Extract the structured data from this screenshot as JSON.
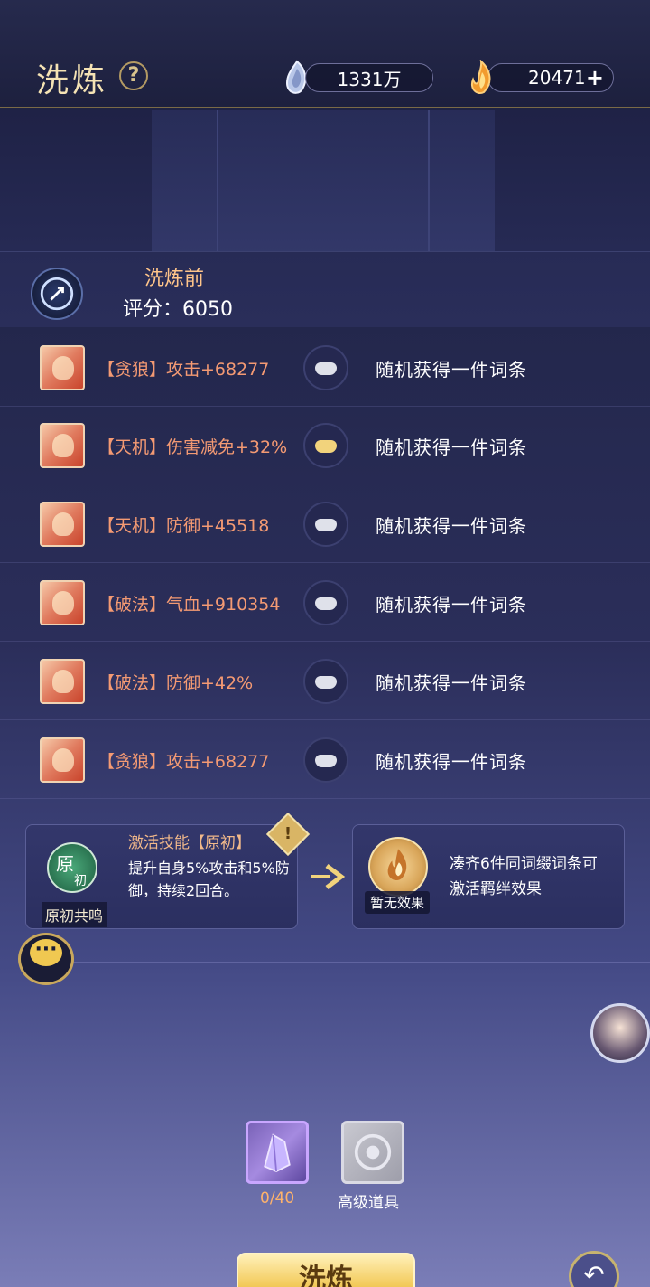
{
  "header": {
    "title": "洗炼",
    "help_icon": "?",
    "currency": [
      {
        "icon": "silver-crystal-icon",
        "value": "1331万"
      },
      {
        "icon": "fire-coin-icon",
        "value": "20471",
        "add": "+"
      }
    ]
  },
  "score": {
    "title": "洗炼前",
    "label": "评分：",
    "value": "6050"
  },
  "rows": [
    {
      "attr": "【贪狼】攻击+68277",
      "locked": false,
      "result": "随机获得一件词条"
    },
    {
      "attr": "【天机】伤害减免+32%",
      "locked": true,
      "result": "随机获得一件词条"
    },
    {
      "attr": "【天机】防御+45518",
      "locked": false,
      "result": "随机获得一件词条"
    },
    {
      "attr": "【破法】气血+910354",
      "locked": false,
      "result": "随机获得一件词条"
    },
    {
      "attr": "【破法】防御+42%",
      "locked": false,
      "result": "随机获得一件词条"
    },
    {
      "attr": "【贪狼】攻击+68277",
      "locked": false,
      "result": "随机获得一件词条"
    }
  ],
  "skill": {
    "badge_top": "原",
    "badge_bottom": "初",
    "name": "原初共鸣",
    "title": "激活技能【原初】",
    "desc": "提升自身5%攻击和5%防御，持续2回合。",
    "warn": "!"
  },
  "bond": {
    "label": "暂无效果",
    "text": "凑齐6件同词缀词条可激活羁绊效果"
  },
  "items": {
    "crystal_count": "0/40",
    "advanced_label": "高级道具"
  },
  "actions": {
    "refine_label": "洗炼",
    "back_icon": "↶"
  },
  "colors": {
    "accent_gold": "#f3cb5c",
    "attr_orange": "#f49a73"
  }
}
